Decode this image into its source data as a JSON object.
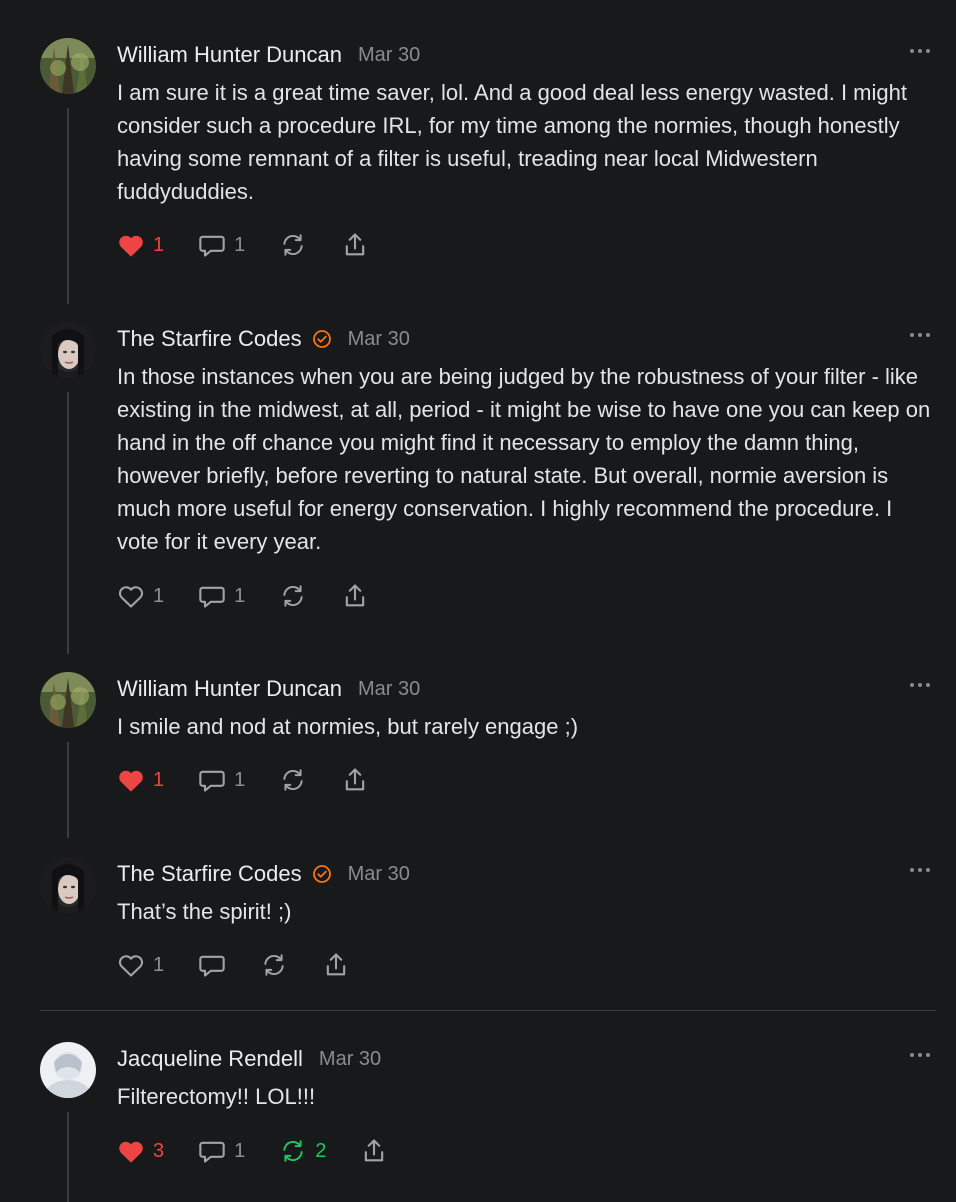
{
  "comments": [
    {
      "author": "William Hunter Duncan",
      "date": "Mar 30",
      "verified": false,
      "text": "I am sure it is a great time saver, lol. And a good deal less energy wasted. I might consider such a procedure IRL, for my time among the normies, though honestly having some remnant of a filter is useful, treading near local Midwestern fuddyduddies.",
      "likes": "1",
      "liked": true,
      "replies": "1",
      "restacks": "",
      "avatar": "forest-avatar"
    },
    {
      "author": "The Starfire Codes",
      "date": "Mar 30",
      "verified": true,
      "text": "In those instances when you are being judged by the robustness of your filter - like existing in the midwest, at all, period - it might be wise to have one you can keep on hand in the off chance you might find it necessary to employ the damn thing, however briefly, before reverting to natural state. But overall, normie aversion is much more useful for energy conservation. I highly recommend the procedure. I vote for it every year.",
      "likes": "1",
      "liked": false,
      "replies": "1",
      "restacks": "",
      "avatar": "portrait-avatar"
    },
    {
      "author": "William Hunter Duncan",
      "date": "Mar 30",
      "verified": false,
      "text": "I smile and nod at normies, but rarely engage ;)",
      "likes": "1",
      "liked": true,
      "replies": "1",
      "restacks": "",
      "avatar": "forest-avatar"
    },
    {
      "author": "The Starfire Codes",
      "date": "Mar 30",
      "verified": true,
      "text": "That’s the spirit! ;)",
      "likes": "1",
      "liked": false,
      "replies": "",
      "restacks": "",
      "avatar": "portrait-avatar"
    },
    {
      "author": "Jacqueline Rendell",
      "date": "Mar 30",
      "verified": false,
      "text": "Filterectomy!! LOL!!!",
      "likes": "3",
      "liked": true,
      "replies": "1",
      "restacks": "2",
      "restacked": true,
      "avatar": "light-avatar"
    }
  ],
  "colors": {
    "background": "#18191b",
    "like_active": "#ef4444",
    "restack_active": "#22c55e",
    "verified": "#f97316",
    "muted": "#8f8f92"
  }
}
